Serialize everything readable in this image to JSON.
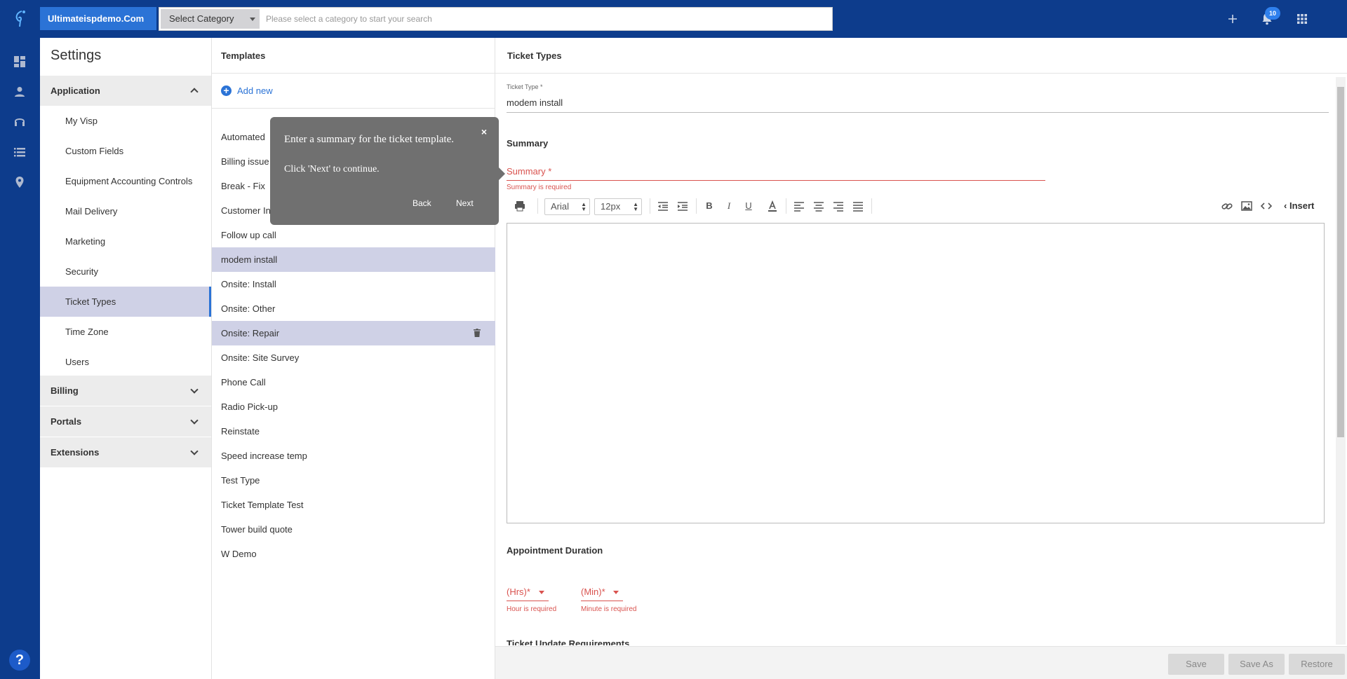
{
  "header": {
    "brand": "Ultimateispdemo.Com",
    "category_select": "Select Category",
    "search_placeholder": "Please select a category to start your search",
    "notification_count": "10"
  },
  "settings": {
    "title": "Settings",
    "sections": [
      {
        "label": "Application",
        "expanded": true
      },
      {
        "label": "Billing",
        "expanded": false
      },
      {
        "label": "Portals",
        "expanded": false
      },
      {
        "label": "Extensions",
        "expanded": false
      }
    ],
    "items": [
      "My Visp",
      "Custom Fields",
      "Equipment Accounting Controls",
      "Mail Delivery",
      "Marketing",
      "Security",
      "Ticket Types",
      "Time Zone",
      "Users"
    ],
    "active_item": "Ticket Types"
  },
  "templates": {
    "title": "Templates",
    "add_new": "Add new",
    "items": [
      "Automated",
      "Billing issue",
      "Break - Fix",
      "Customer In",
      "Follow up call",
      "modem install",
      "Onsite: Install",
      "Onsite: Other",
      "Onsite: Repair",
      "Onsite: Site Survey",
      "Phone Call",
      "Radio Pick-up",
      "Reinstate",
      "Speed increase temp",
      "Test Type",
      "Ticket Template Test",
      "Tower build quote",
      "W Demo"
    ]
  },
  "tour": {
    "text": "Enter a summary for the ticket template.",
    "hint": "Click 'Next' to continue.",
    "back": "Back",
    "next": "Next",
    "close": "×"
  },
  "detail": {
    "title": "Ticket Types",
    "ticket_type_label": "Ticket Type *",
    "ticket_type_value": "modem install",
    "summary_heading": "Summary",
    "summary_label": "Summary *",
    "summary_error": "Summary is required",
    "toolbar": {
      "font": "Arial",
      "size": "12px",
      "insert": "Insert"
    },
    "appointment_heading": "Appointment Duration",
    "hrs_label": "(Hrs)*",
    "min_label": "(Min)*",
    "hrs_error": "Hour is required",
    "min_error": "Minute is required",
    "requirements_heading": "Ticket Update Requirements",
    "buttons": {
      "save": "Save",
      "save_as": "Save As",
      "restore": "Restore"
    }
  },
  "colors": {
    "topbar": "#0d3c8c",
    "accent": "#2b73d6",
    "selected_row": "#cfd1e6",
    "error": "#d9534f"
  }
}
